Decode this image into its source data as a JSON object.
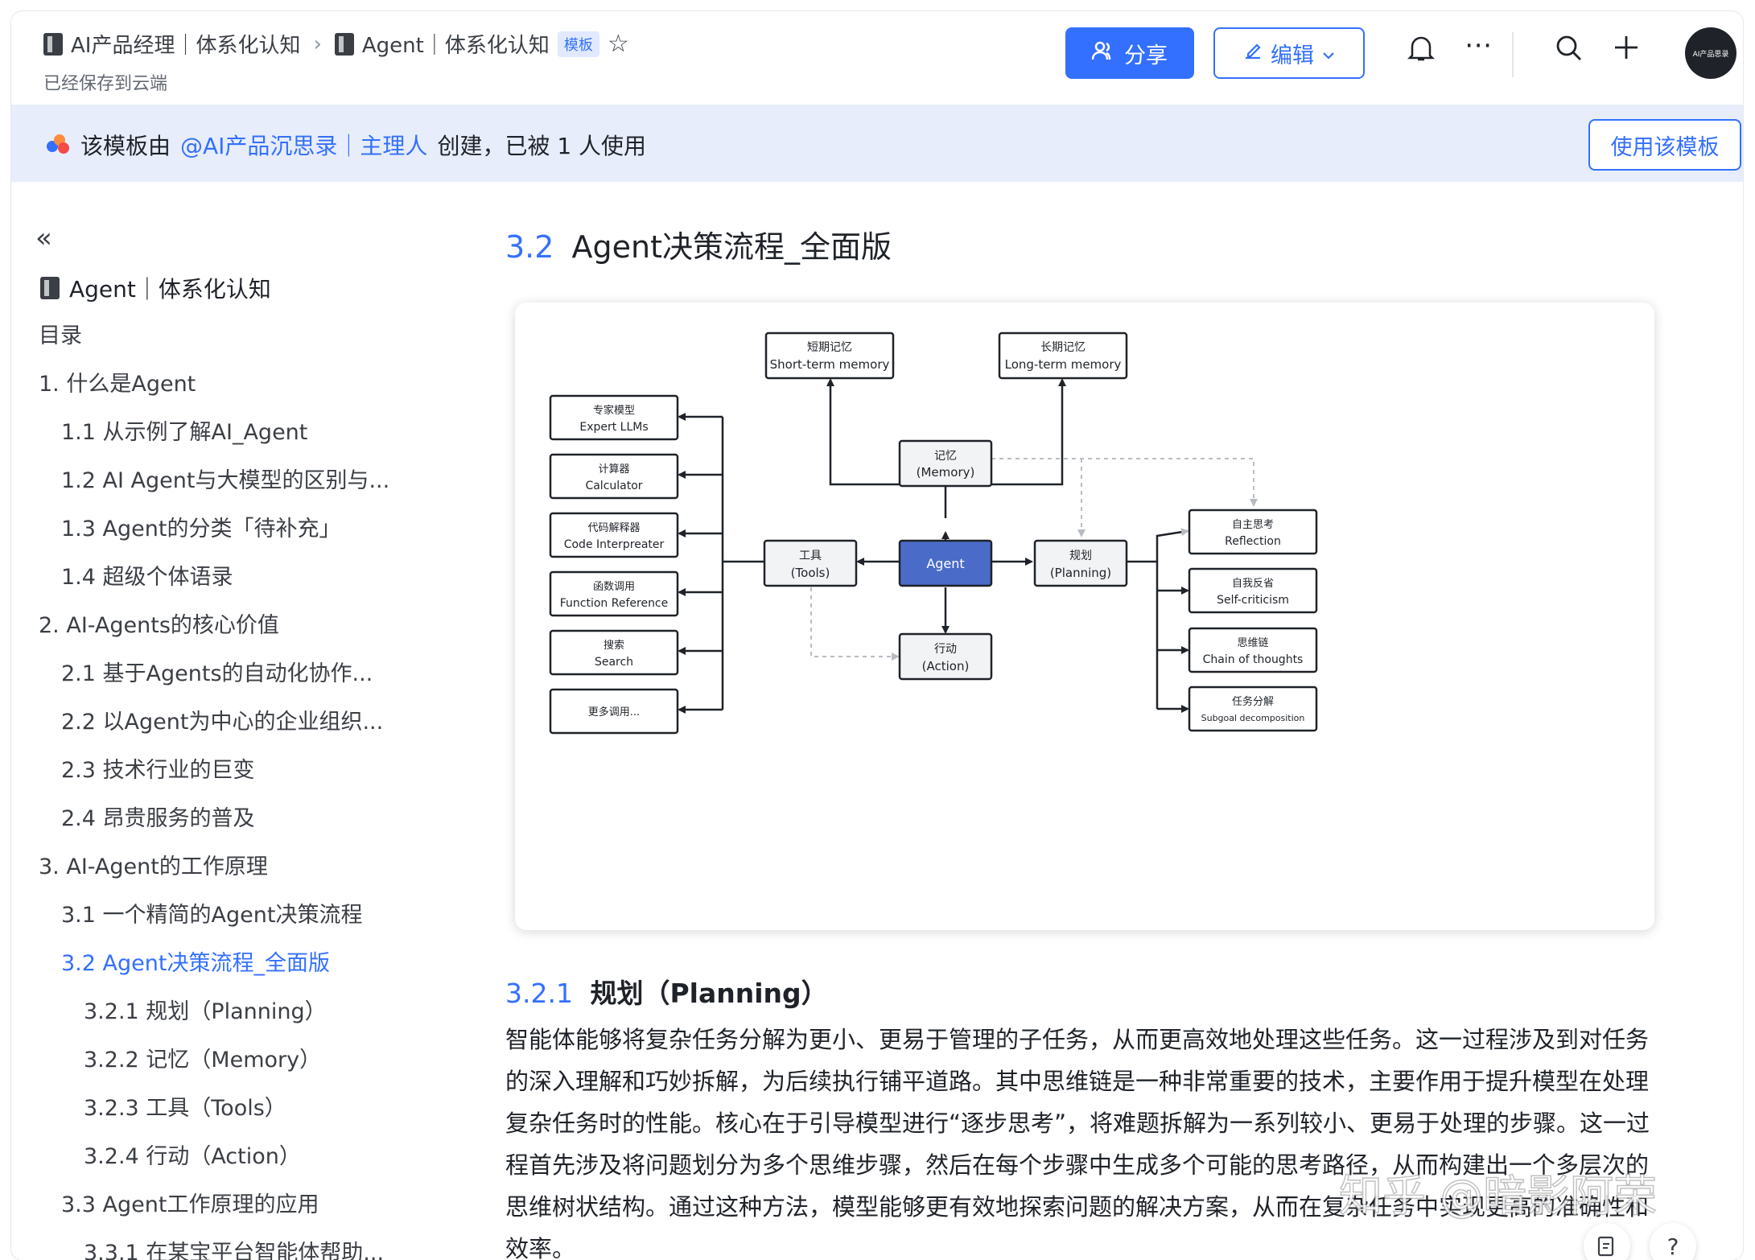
{
  "header": {
    "breadcrumb": [
      {
        "label": "AI产品经理｜体系化认知"
      },
      {
        "label": "Agent｜体系化认知"
      }
    ],
    "template_tag": "模板",
    "saved_status": "已经保存到云端",
    "share_label": "分享",
    "edit_label": "编辑",
    "avatar_text": "AI产品思录"
  },
  "banner": {
    "prefix": "该模板由",
    "author": "@AI产品沉思录｜主理人",
    "suffix": "创建，已被 1 人使用",
    "use_button": "使用该模板"
  },
  "sidebar": {
    "doc_title": "Agent｜体系化认知",
    "toc": [
      {
        "label": "目录",
        "level": 0
      },
      {
        "label": "1. 什么是Agent",
        "level": 0
      },
      {
        "label": "1.1 从示例了解AI_Agent",
        "level": 1
      },
      {
        "label": "1.2 AI Agent与大模型的区别与...",
        "level": 1
      },
      {
        "label": "1.3 Agent的分类「待补充」",
        "level": 1
      },
      {
        "label": "1.4 超级个体语录",
        "level": 1
      },
      {
        "label": "2. AI-Agents的核心价值",
        "level": 0
      },
      {
        "label": "2.1 基于Agents的自动化协作...",
        "level": 1
      },
      {
        "label": "2.2 以Agent为中心的企业组织...",
        "level": 1
      },
      {
        "label": "2.3 技术行业的巨变",
        "level": 1
      },
      {
        "label": "2.4 昂贵服务的普及",
        "level": 1
      },
      {
        "label": "3. AI-Agent的工作原理",
        "level": 0
      },
      {
        "label": "3.1 一个精简的Agent决策流程",
        "level": 1
      },
      {
        "label": "3.2 Agent决策流程_全面版",
        "level": 1,
        "active": true
      },
      {
        "label": "3.2.1 规划（Planning）",
        "level": 2
      },
      {
        "label": "3.2.2 记忆（Memory）",
        "level": 2
      },
      {
        "label": "3.2.3 工具（Tools）",
        "level": 2
      },
      {
        "label": "3.2.4 行动（Action）",
        "level": 2
      },
      {
        "label": "3.3 Agent工作原理的应用",
        "level": 1
      },
      {
        "label": "3.3.1 在某宝平台智能体帮助...",
        "level": 2
      }
    ]
  },
  "main": {
    "section_num": "3.2",
    "section_title": "Agent决策流程_全面版",
    "subsection_num": "3.2.1",
    "subsection_title": "规划（Planning）",
    "paragraph": "智能体能够将复杂任务分解为更小、更易于管理的子任务，从而更高效地处理这些任务。这一过程涉及到对任务的深入理解和巧妙拆解，为后续执行铺平道路。其中思维链是一种非常重要的技术，主要作用于提升模型在处理复杂任务时的性能。核心在于引导模型进行“逐步思考”，将难题拆解为一系列较小、更易于处理的步骤。这一过程首先涉及将问题划分为多个思维步骤，然后在每个步骤中生成多个可能的思考路径，从而构建出一个多层次的思维树状结构。通过这种方法，模型能够更有效地探索问题的解决方案，从而在复杂任务中实现更高的准确性和效率。",
    "watermark": "知乎 @暗影阿荣"
  },
  "diagram": {
    "agent": {
      "l1": "Agent"
    },
    "memory": {
      "l1": "记忆",
      "l2": "(Memory)"
    },
    "short_term": {
      "l1": "短期记忆",
      "l2": "Short-term memory"
    },
    "long_term": {
      "l1": "长期记忆",
      "l2": "Long-term memory"
    },
    "tools": {
      "l1": "工具",
      "l2": "(Tools)"
    },
    "planning": {
      "l1": "规划",
      "l2": "(Planning)"
    },
    "action": {
      "l1": "行动",
      "l2": "(Action)"
    },
    "expert": {
      "l1": "专家模型",
      "l2": "Expert LLMs"
    },
    "calculator": {
      "l1": "计算器",
      "l2": "Calculator"
    },
    "code": {
      "l1": "代码解释器",
      "l2": "Code Interpreater"
    },
    "function": {
      "l1": "函数调用",
      "l2": "Function Reference"
    },
    "search": {
      "l1": "搜索",
      "l2": "Search"
    },
    "more": {
      "l1": "更多调用..."
    },
    "reflection": {
      "l1": "自主思考",
      "l2": "Reflection"
    },
    "selfcrit": {
      "l1": "自我反省",
      "l2": "Self-criticism"
    },
    "cot": {
      "l1": "思维链",
      "l2": "Chain of thoughts"
    },
    "subgoal": {
      "l1": "任务分解",
      "l2": "Subgoal decomposition"
    }
  },
  "colors": {
    "accent": "#3370ff",
    "agent_fill": "#4a6bc7",
    "banner_bg": "#e8edfb"
  }
}
